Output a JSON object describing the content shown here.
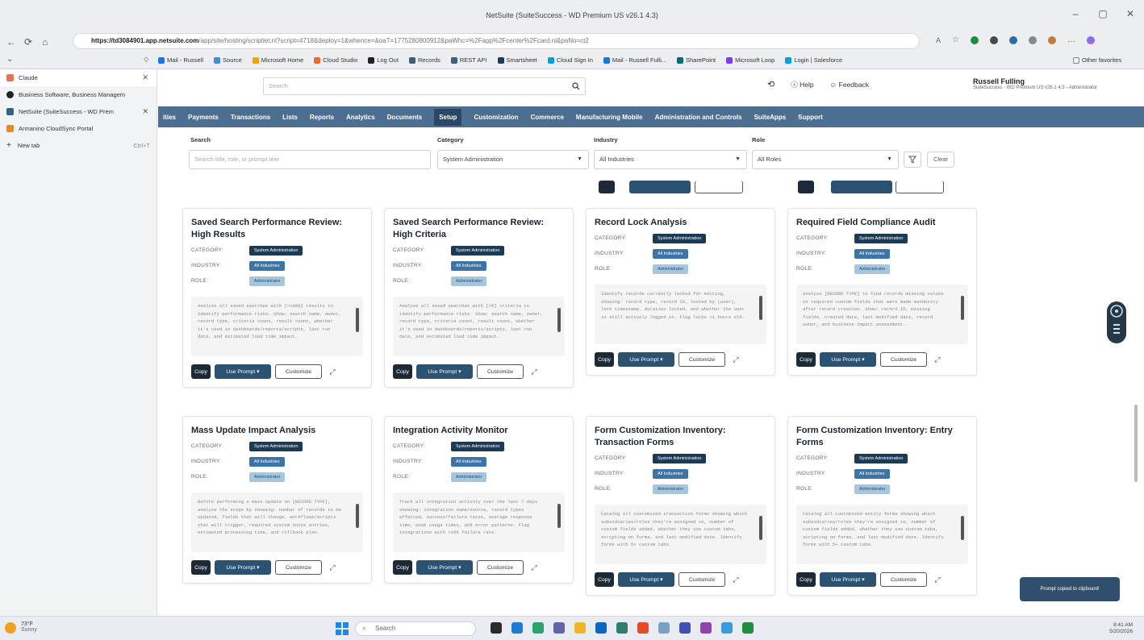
{
  "window": {
    "title": "NetSuite (SuiteSuccess - WD Premium US v26.1 4.3)",
    "controls": [
      "–",
      "▢",
      "✕"
    ]
  },
  "address": {
    "host": "https://td3084901.app.netsuite.com",
    "path": "/app/site/hosting/scriptlet.nl?script=4718&deploy=1&whence=&oaT=1775280800912&paWhc=%2Fapp%2Fcenter%2Fcard.nl&paNo=ct2"
  },
  "bookmarks": [
    "Mail - Russell",
    "Source",
    "Microsoft Home",
    "Cloud Studio",
    "Log Out",
    "Records",
    "REST API",
    "Smartsheet",
    "Cloud Sign In",
    "Mail - Russell Fulli...",
    "SharePoint",
    "Microsoft Loop",
    "Login | Salesforce"
  ],
  "other_favorites": "Other favorites",
  "tabs": [
    {
      "label": "Claude",
      "active": true,
      "color": "#d97757"
    },
    {
      "label": "Business Software, Business Managem",
      "color": "#222222"
    },
    {
      "label": "NetSuite (SuiteSuccess - WD Prem",
      "color": "#3b5f7f"
    },
    {
      "label": "Armanino CloudSync Portal",
      "color": "#e08a2a"
    }
  ],
  "new_tab": {
    "label": "New tab",
    "shortcut": "Ctrl+T"
  },
  "header": {
    "search_placeholder": "Search",
    "help": "Help",
    "feedback": "Feedback",
    "user_name": "Russell Fulling",
    "user_role": "SuiteSuccess - WD Premium US v26.1 4.3 - Administrator"
  },
  "nav": [
    "ities",
    "Payments",
    "Transactions",
    "Lists",
    "Reports",
    "Analytics",
    "Documents",
    "Setup",
    "Customization",
    "Commerce",
    "Manufacturing Mobile",
    "Administration and Controls",
    "SuiteApps",
    "Support"
  ],
  "nav_selected": "Setup",
  "filters": {
    "search_label": "Search",
    "search_placeholder": "Search title, role, or prompt text",
    "category_label": "Category",
    "category_value": "System Administration",
    "industry_label": "Industry",
    "industry_value": "All Industries",
    "role_label": "Role",
    "role_value": "All Roles",
    "clear": "Clear"
  },
  "labels": {
    "category": "CATEGORY:",
    "industry": "INDUSTRY:",
    "role": "ROLE:",
    "copy": "Copy",
    "use_prompt": "Use Prompt ▾",
    "customize": "Customize"
  },
  "cards": [
    {
      "title": "Saved Search Performance Review: High Results",
      "category": "System Administration",
      "industry": "All Industries",
      "role": "Administrator",
      "prompt": "Analyze all saved searches with [>1000] results to identify performance risks. Show: search name, owner, record type, criteria count, result count, whether it's used in dashboards/reports/scripts, last run date, and estimated load time impact."
    },
    {
      "title": "Saved Search Performance Review: High Criteria",
      "category": "System Administration",
      "industry": "All Industries",
      "role": "Administrator",
      "prompt": "Analyze all saved searches with [>5] criteria to identify performance risks. Show: search name, owner, record type, criteria count, result count, whether it's used in dashboards/reports/scripts, last run date, and estimated load time impact."
    },
    {
      "title": "Record Lock Analysis",
      "category": "System Administration",
      "industry": "All Industries",
      "role": "Administrator",
      "prompt": "Identify records currently locked for editing, showing: record type, record ID, locked by (user), lock timestamp, duration locked, and whether the user is still actively logged in. Flag locks >1 hours old."
    },
    {
      "title": "Required Field Compliance Audit",
      "category": "System Administration",
      "industry": "All Industries",
      "role": "Administrator",
      "prompt": "Analyze [RECORD TYPE] to find records missing values in required custom fields that were made mandatory after record creation. Show: record ID, missing fields, created date, last modified date, record owner, and business impact assessment."
    },
    {
      "title": "Mass Update Impact Analysis",
      "category": "System Administration",
      "industry": "All Industries",
      "role": "Administrator",
      "prompt": "Before performing a mass update on [RECORD TYPE], analyze the scope by showing: number of records to be updated, fields that will change, workflows/scripts that will trigger, required system notes entries, estimated processing time, and rollback plan."
    },
    {
      "title": "Integration Activity Monitor",
      "category": "System Administration",
      "industry": "All Industries",
      "role": "Administrator",
      "prompt": "Track all integration activity over the last 7 days showing: integration name/source, record types affected, success/failure rates, average response time, peak usage times, and error patterns. Flag integrations with >10% failure rate."
    },
    {
      "title": "Form Customization Inventory: Transaction Forms",
      "category": "System Administration",
      "industry": "All Industries",
      "role": "Administrator",
      "prompt": "Catalog all customized transaction forms showing which subsidiaries/roles they're assigned to, number of custom fields added, whether they use custom tabs, scripting on forms, and last modified date. Identify forms with 5+ custom tabs."
    },
    {
      "title": "Form Customization Inventory: Entry Forms",
      "category": "System Administration",
      "industry": "All Industries",
      "role": "Administrator",
      "prompt": "Catalog all customized entity forms showing which subsidiaries/roles they're assigned to, number of custom fields added, whether they use custom tabs, scripting on forms, and last modified date. Identify forms with 5+ custom tabs."
    }
  ],
  "toast": "Prompt copied to clipboard!",
  "taskbar": {
    "temp": "73°F",
    "weather": "Sunny",
    "search": "Search",
    "time": "8:41 AM",
    "date": "5/20/2026"
  },
  "colors": {
    "nav": "#4c6f91",
    "category_chip": "#1d3a55",
    "industry_chip": "#3d74a8",
    "role_chip": "#a6c6de"
  }
}
